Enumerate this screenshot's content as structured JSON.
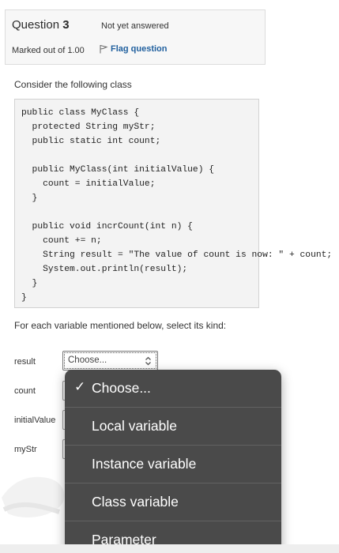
{
  "question": {
    "label": "Question",
    "number": "3",
    "status": "Not yet answered",
    "marks": "Marked out of 1.00",
    "flag_label": "Flag question"
  },
  "prompt": "Consider the following class",
  "code": {
    "lines": [
      "public class MyClass {",
      "  protected String myStr;",
      "  public static int count;",
      "",
      "  public MyClass(int initialValue) {",
      "    count = initialValue;",
      "  }",
      "",
      "  public void incrCount(int n) {",
      "    count += n;",
      "    String result = \"The value of count is now: \" + count;",
      "    System.out.println(result);",
      "  }",
      "}"
    ]
  },
  "instruction": "For each variable mentioned below, select its kind:",
  "variables": [
    {
      "name": "result",
      "selected": "Choose..."
    },
    {
      "name": "count"
    },
    {
      "name": "initialValue"
    },
    {
      "name": "myStr"
    }
  ],
  "dropdown": {
    "options": [
      "Choose...",
      "Local variable",
      "Instance variable",
      "Class variable",
      "Parameter"
    ],
    "checked_index": 0,
    "check_glyph": "✓"
  }
}
